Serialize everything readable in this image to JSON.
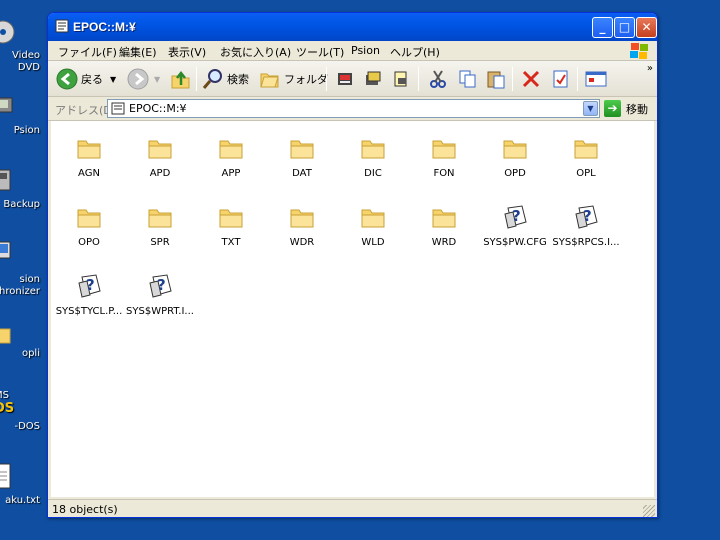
{
  "desktop": {
    "icons": [
      {
        "label": "Video\nDVD",
        "icon": "dvd-icon"
      },
      {
        "label": "Psion",
        "icon": "psion-device-icon"
      },
      {
        "label": "Backup",
        "icon": "backup-icon"
      },
      {
        "label": "sion\nhronizer",
        "icon": "synchronizer-icon"
      },
      {
        "label": "opli",
        "icon": "folder-icon"
      },
      {
        "label": "-DOS",
        "icon": "msdos-icon"
      },
      {
        "label": "aku.txt",
        "icon": "text-file-icon"
      }
    ]
  },
  "window": {
    "title": "EPOC::M:¥",
    "controls": {
      "minimize": "_",
      "maximize": "□",
      "close": "✕"
    }
  },
  "menu": {
    "items": [
      "ファイル(F)",
      "編集(E)",
      "表示(V)",
      "お気に入り(A)",
      "ツール(T)",
      "Psion",
      "ヘルプ(H)"
    ]
  },
  "toolbar": {
    "back_label": "戻る",
    "search_label": "検索",
    "folders_label": "フォルダ",
    "more": "»"
  },
  "address": {
    "label": "アドレス(D)",
    "value": "EPOC::M:¥",
    "go_label": "移動"
  },
  "files": [
    {
      "name": "AGN",
      "type": "folder"
    },
    {
      "name": "APD",
      "type": "folder"
    },
    {
      "name": "APP",
      "type": "folder"
    },
    {
      "name": "DAT",
      "type": "folder"
    },
    {
      "name": "DIC",
      "type": "folder"
    },
    {
      "name": "FON",
      "type": "folder"
    },
    {
      "name": "OPD",
      "type": "folder"
    },
    {
      "name": "OPL",
      "type": "folder"
    },
    {
      "name": "OPO",
      "type": "folder"
    },
    {
      "name": "SPR",
      "type": "folder"
    },
    {
      "name": "TXT",
      "type": "folder"
    },
    {
      "name": "WDR",
      "type": "folder"
    },
    {
      "name": "WLD",
      "type": "folder"
    },
    {
      "name": "WRD",
      "type": "folder"
    },
    {
      "name": "SYS$PW.CFG",
      "type": "unknown"
    },
    {
      "name": "SYS$RPCS.I...",
      "type": "unknown"
    },
    {
      "name": "SYS$TYCL.P...",
      "type": "unknown"
    },
    {
      "name": "SYS$WPRT.I...",
      "type": "unknown"
    }
  ],
  "status": {
    "text": "18 object(s)"
  },
  "colors": {
    "desktop": "#0f4ea1",
    "titlebar": "#0054e3",
    "folder": "#f7d36b"
  }
}
